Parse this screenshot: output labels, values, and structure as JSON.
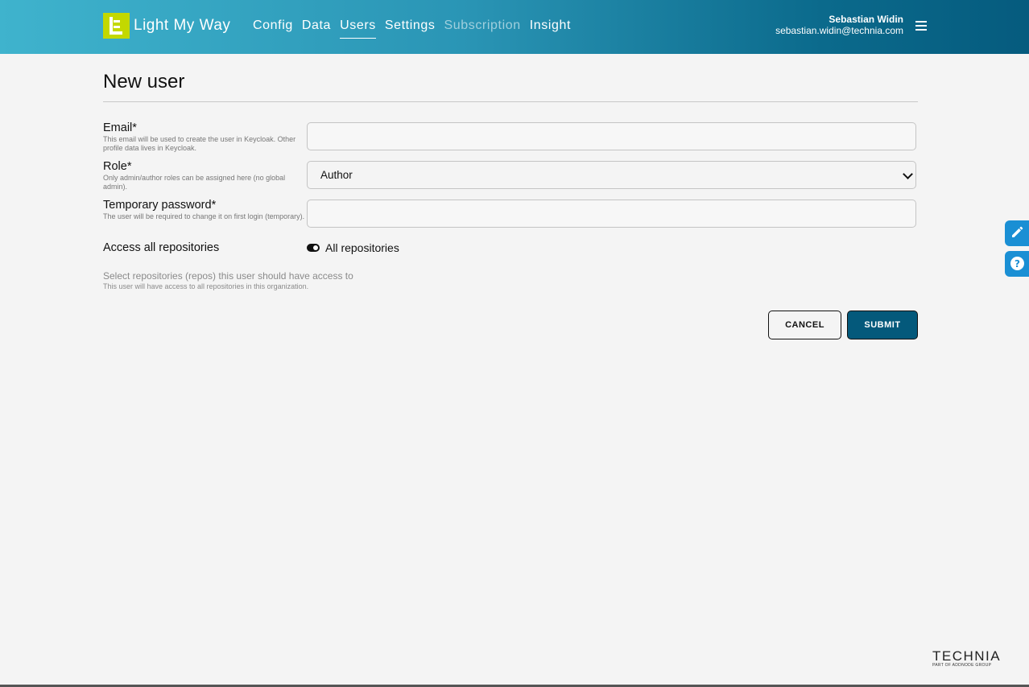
{
  "header": {
    "app_title": "Light My Way",
    "nav": [
      {
        "label": "Config",
        "state": "normal"
      },
      {
        "label": "Data",
        "state": "normal"
      },
      {
        "label": "Users",
        "state": "active"
      },
      {
        "label": "Settings",
        "state": "normal"
      },
      {
        "label": "Subscription",
        "state": "disabled"
      },
      {
        "label": "Insight",
        "state": "normal"
      }
    ],
    "user_name": "Sebastian Widin",
    "user_email": "sebastian.widin@technia.com",
    "menu_icon": "hamburger-icon"
  },
  "form": {
    "title": "New user",
    "email": {
      "label": "Email*",
      "hint": "This email will be used to create the user in Keycloak. Other profile data lives in Keycloak.",
      "value": ""
    },
    "role": {
      "label": "Role*",
      "hint": "Only admin/author roles can be assigned here (no global admin).",
      "value": "Author"
    },
    "password": {
      "label": "Temporary password*",
      "hint": "The user will be required to change it on first login (temporary).",
      "value": ""
    },
    "access": {
      "label": "Access all repositories",
      "toggle_label": "All repositories",
      "toggle_on": true
    },
    "repos": {
      "title": "Select repositories (repos) this user should have access to",
      "hint": "This user will have access to all repositories in this organization."
    },
    "cancel_label": "CANCEL",
    "submit_label": "SUBMIT"
  },
  "side_tabs": [
    {
      "icon": "pencil-icon"
    },
    {
      "icon": "help-icon"
    }
  ],
  "footer": {
    "brand": "TECHNIA",
    "tagline": "PART OF ADDNODE GROUP"
  },
  "colors": {
    "header_start": "#3fb3cd",
    "header_end": "#055b7e",
    "logo": "#c3d800",
    "submit": "#04597b",
    "side_tab": "#1a8fd4"
  }
}
